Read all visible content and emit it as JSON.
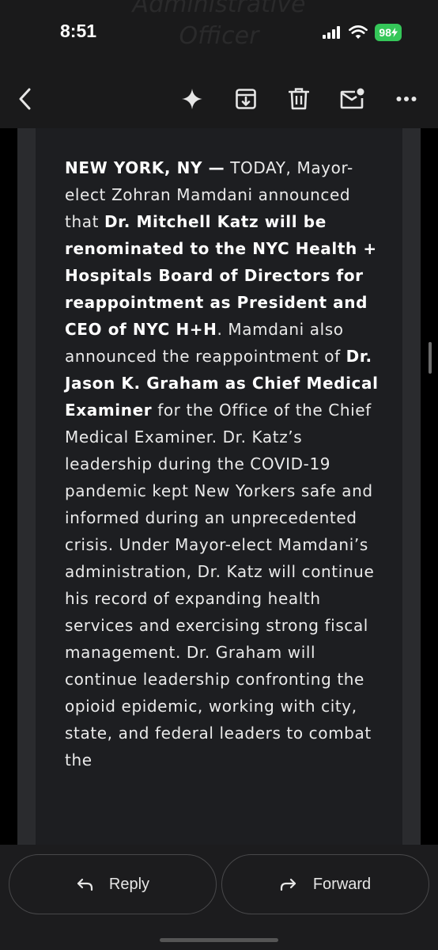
{
  "status": {
    "time": "8:51",
    "battery": "98",
    "ghost_title_line1": "Administrative",
    "ghost_title_line2": "Officer"
  },
  "toolbar": {
    "back_icon": "chevron-left-icon",
    "gemini_icon": "sparkle-icon",
    "archive_icon": "archive-icon",
    "delete_icon": "trash-icon",
    "unread_icon": "mail-unread-icon",
    "more_icon": "more-horizontal-icon"
  },
  "email": {
    "p1": "NEW YORK, NY —",
    "p2": " TODAY, Mayor-elect Zohran Mamdani announced that ",
    "p3": "Dr. Mitchell Katz will be renominated to the NYC Health + Hospitals Board of Directors for reappointment as President and CEO of NYC H+H",
    "p4": ". Mamdani also announced the reappointment of ",
    "p5": "Dr. Jason K. Graham as Chief Medical Examiner",
    "p6": " for the Office of the Chief Medical Examiner. Dr. Katz’s leadership during the COVID-19 pandemic kept New Yorkers safe and informed during an unprecedented crisis. Under Mayor-elect Mamdani’s administration, Dr. Katz will continue his record of expanding health services and exercising strong fiscal management. Dr. Graham will continue leadership confronting the opioid epidemic, working with city, state, and federal leaders to combat the"
  },
  "actions": {
    "reply_label": "Reply",
    "forward_label": "Forward"
  },
  "colors": {
    "background": "#000000",
    "card": "#1d1e21",
    "battery": "#35c759"
  }
}
